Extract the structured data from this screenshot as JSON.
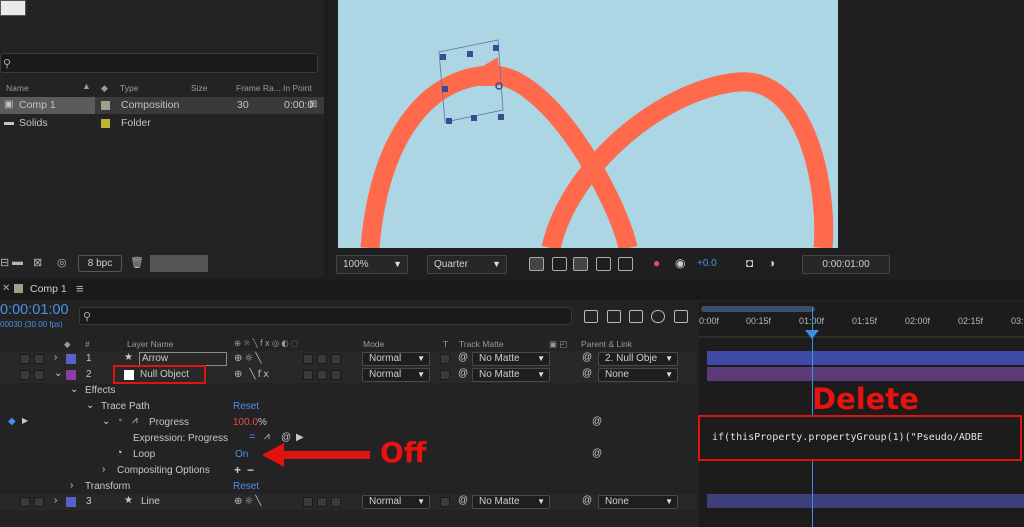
{
  "project": {
    "columns": [
      "Name",
      "Type",
      "Size",
      "Frame Ra...",
      "In Point"
    ],
    "items": [
      {
        "name": "Comp 1",
        "type": "Composition",
        "frame_rate": "30",
        "in_point": "0:00:0",
        "label_color": "#a09f8c"
      },
      {
        "name": "Solids",
        "type": "Folder",
        "frame_rate": "",
        "in_point": "",
        "label_color": "#bcb23a"
      }
    ],
    "bpc": "8 bpc"
  },
  "viewer": {
    "zoom": "100%",
    "resolution": "Quarter",
    "exposure": "+0.0",
    "time": "0:00:01:00"
  },
  "timeline": {
    "tab": "Comp 1",
    "timecode": "0:00:01:00",
    "fps": "00030 (30.00 fps)",
    "columns": {
      "num": "#",
      "layer_name": "Layer Name",
      "mode": "Mode",
      "t": "T",
      "track_matte": "Track Matte",
      "parent": "Parent & Link"
    },
    "layers": [
      {
        "num": "1",
        "name": "Arrow",
        "mode": "Normal",
        "matte": "No Matte",
        "parent": "2. Null Obje",
        "label_color": "#5b5fc7"
      },
      {
        "num": "2",
        "name": "Null Object",
        "mode": "Normal",
        "matte": "No Matte",
        "parent": "None",
        "label_color": "#8a3fa0"
      },
      {
        "num": "3",
        "name": "Line",
        "mode": "Normal",
        "matte": "No Matte",
        "parent": "None",
        "label_color": "#5b5fc7"
      }
    ],
    "effects_label": "Effects",
    "trace_path": {
      "label": "Trace Path",
      "reset": "Reset"
    },
    "progress": {
      "label": "Progress",
      "value": "100.0",
      "unit": "%"
    },
    "expression": {
      "label": "Expression: Progress",
      "code": "if(thisProperty.propertyGroup(1)(\"Pseudo/ADBE"
    },
    "loop": {
      "label": "Loop",
      "value": "On"
    },
    "compositing": "Compositing Options",
    "transform": {
      "label": "Transform",
      "reset": "Reset"
    },
    "ruler": [
      "0:00f",
      "00:15f",
      "01:00f",
      "01:15f",
      "02:00f",
      "02:15f",
      "03:"
    ]
  },
  "annotations": {
    "delete": "Delete",
    "off": "Off"
  },
  "colors": {
    "accent_blue": "#4d8fe8",
    "annotation_red": "#e0140f",
    "path": "#ff6a4d",
    "canvas_bg": "#acd6e4"
  }
}
